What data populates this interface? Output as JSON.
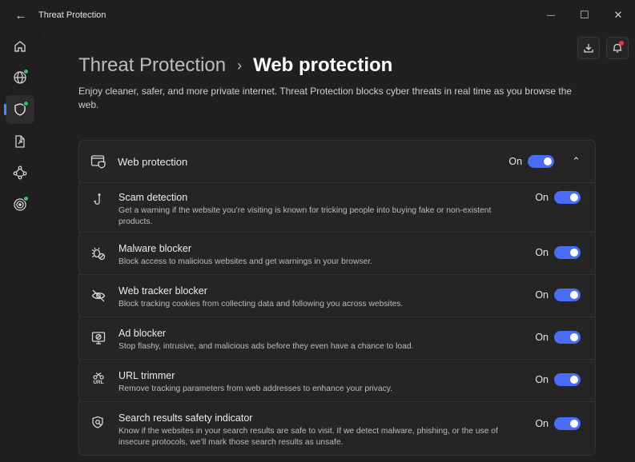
{
  "window": {
    "title": "Threat Protection",
    "back_glyph": "←",
    "minimize_glyph": "—",
    "maximize_glyph": "☐",
    "close_glyph": "✕"
  },
  "rail": {
    "items": [
      {
        "icon": "home-icon"
      },
      {
        "icon": "globe-icon",
        "badge": true
      },
      {
        "icon": "shield-icon",
        "active": true,
        "badge": true
      },
      {
        "icon": "file-share-icon"
      },
      {
        "icon": "mesh-network-icon"
      },
      {
        "icon": "target-icon",
        "badge": true
      }
    ],
    "accent": "#4a8cff",
    "badge_color": "#3fbf6a"
  },
  "header": {
    "breadcrumb_parent": "Threat Protection",
    "breadcrumb_separator": "›",
    "breadcrumb_current": "Web protection",
    "description": "Enjoy cleaner, safer, and more private internet. Threat Protection blocks cyber threats in real time as you browse the web."
  },
  "card": {
    "title": "Web protection",
    "state": "On",
    "chevron": "⌃",
    "rows": [
      {
        "title": "Scam detection",
        "description": "Get a warning if the website you’re visiting is known for tricking people into buying fake or non-existent products.",
        "state": "On",
        "icon": "hook-icon"
      },
      {
        "title": "Malware blocker",
        "description": "Block access to malicious websites and get warnings in your browser.",
        "state": "On",
        "icon": "bug-blocked-icon"
      },
      {
        "title": "Web tracker blocker",
        "description": "Block tracking cookies from collecting data and following you across websites.",
        "state": "On",
        "icon": "eye-off-icon"
      },
      {
        "title": "Ad blocker",
        "description": "Stop flashy, intrusive, and malicious ads before they even have a chance to load.",
        "state": "On",
        "icon": "ad-block-monitor-icon"
      },
      {
        "title": "URL trimmer",
        "description": "Remove tracking parameters from web addresses to enhance your privacy.",
        "state": "On",
        "icon": "url-trim-icon",
        "icon_text": "URL"
      },
      {
        "title": "Search results safety indicator",
        "description": "Know if the websites in your search results are safe to visit. If we detect malware, phishing, or the use of insecure protocols, we’ll mark those search results as unsafe.",
        "state": "On",
        "icon": "search-shield-icon"
      }
    ]
  },
  "colors": {
    "toggle_on": "#4a6cf7",
    "notification_dot": "#e53935"
  }
}
